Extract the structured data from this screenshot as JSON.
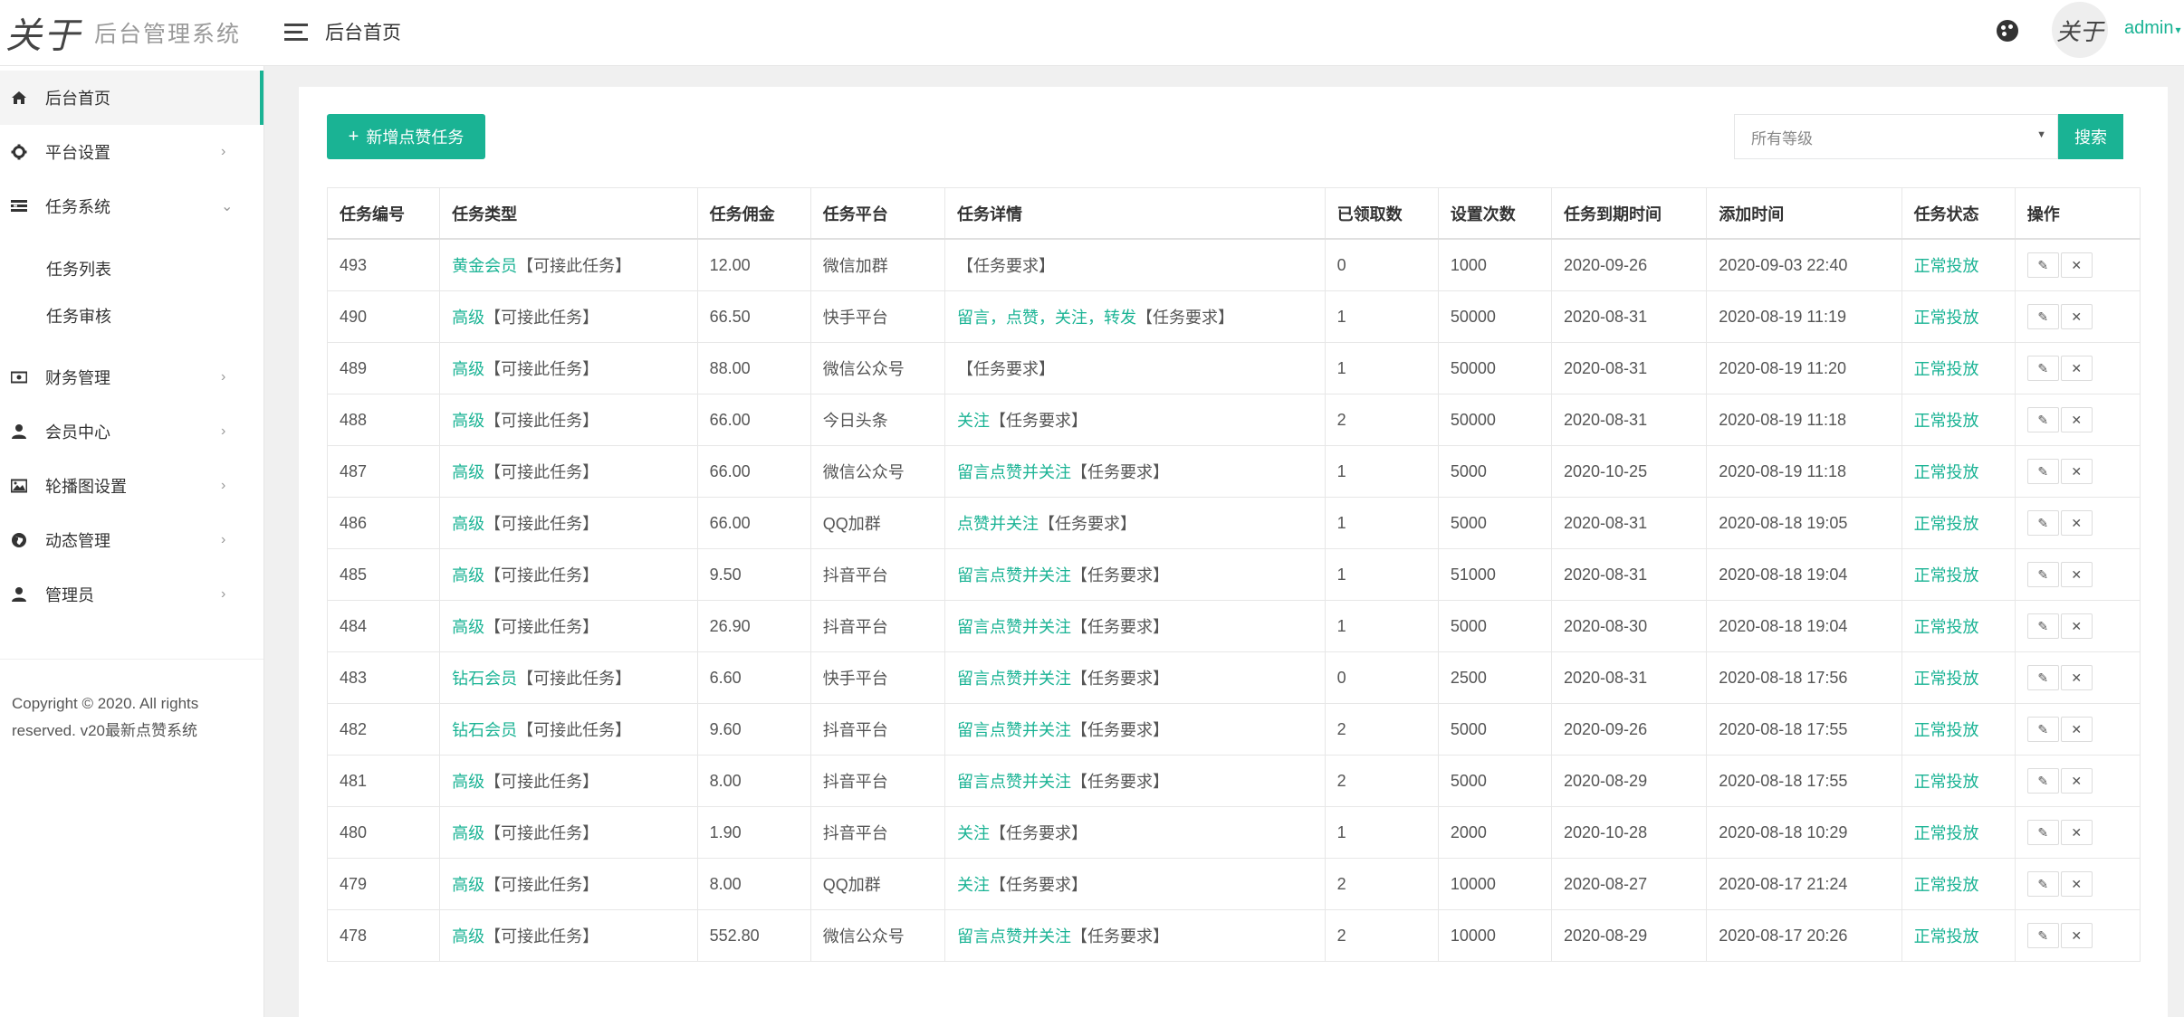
{
  "header": {
    "logo_mark": "关于",
    "system_title": "后台管理系统",
    "page_title": "后台首页",
    "avatar_text": "关于",
    "user_name": "admin"
  },
  "sidebar": {
    "items": [
      {
        "label": "后台首页",
        "icon": "home-icon"
      },
      {
        "label": "平台设置",
        "icon": "gear-icon"
      },
      {
        "label": "任务系统",
        "icon": "tasks-icon"
      },
      {
        "label": "财务管理",
        "icon": "money-icon"
      },
      {
        "label": "会员中心",
        "icon": "user-icon"
      },
      {
        "label": "轮播图设置",
        "icon": "picture-icon"
      },
      {
        "label": "动态管理",
        "icon": "globe-icon"
      },
      {
        "label": "管理员",
        "icon": "user-icon"
      }
    ],
    "sub_items": [
      {
        "label": "任务列表"
      },
      {
        "label": "任务审核"
      }
    ],
    "copyright_line1": "Copyright © 2020. All rights",
    "copyright_line2": "reserved. v20最新点赞系统"
  },
  "toolbar": {
    "add_label": "新增点赞任务",
    "select_value": "所有等级",
    "search_label": "搜索"
  },
  "table": {
    "headers": [
      "任务编号",
      "任务类型",
      "任务佣金",
      "任务平台",
      "任务详情",
      "已领取数",
      "设置次数",
      "任务到期时间",
      "添加时间",
      "任务状态",
      "操作"
    ],
    "rows": [
      {
        "id": "493",
        "type_level": "黄金会员",
        "type_note": "【可接此任务】",
        "commission": "12.00",
        "platform": "微信加群",
        "detail_tags": "",
        "detail_note": "【任务要求】",
        "received": "0",
        "times": "1000",
        "expire": "2020-09-26",
        "added": "2020-09-03 22:40",
        "status": "正常投放"
      },
      {
        "id": "490",
        "type_level": "高级",
        "type_note": "【可接此任务】",
        "commission": "66.50",
        "platform": "快手平台",
        "detail_tags": "留言，点赞，关注，转发",
        "detail_note": "【任务要求】",
        "received": "1",
        "times": "50000",
        "expire": "2020-08-31",
        "added": "2020-08-19 11:19",
        "status": "正常投放"
      },
      {
        "id": "489",
        "type_level": "高级",
        "type_note": "【可接此任务】",
        "commission": "88.00",
        "platform": "微信公众号",
        "detail_tags": "",
        "detail_note": "【任务要求】",
        "received": "1",
        "times": "50000",
        "expire": "2020-08-31",
        "added": "2020-08-19 11:20",
        "status": "正常投放"
      },
      {
        "id": "488",
        "type_level": "高级",
        "type_note": "【可接此任务】",
        "commission": "66.00",
        "platform": "今日头条",
        "detail_tags": "关注",
        "detail_note": "【任务要求】",
        "received": "2",
        "times": "50000",
        "expire": "2020-08-31",
        "added": "2020-08-19 11:18",
        "status": "正常投放"
      },
      {
        "id": "487",
        "type_level": "高级",
        "type_note": "【可接此任务】",
        "commission": "66.00",
        "platform": "微信公众号",
        "detail_tags": "留言点赞并关注",
        "detail_note": "【任务要求】",
        "received": "1",
        "times": "5000",
        "expire": "2020-10-25",
        "added": "2020-08-19 11:18",
        "status": "正常投放"
      },
      {
        "id": "486",
        "type_level": "高级",
        "type_note": "【可接此任务】",
        "commission": "66.00",
        "platform": "QQ加群",
        "detail_tags": "点赞并关注",
        "detail_note": "【任务要求】",
        "received": "1",
        "times": "5000",
        "expire": "2020-08-31",
        "added": "2020-08-18 19:05",
        "status": "正常投放"
      },
      {
        "id": "485",
        "type_level": "高级",
        "type_note": "【可接此任务】",
        "commission": "9.50",
        "platform": "抖音平台",
        "detail_tags": "留言点赞并关注",
        "detail_note": "【任务要求】",
        "received": "1",
        "times": "51000",
        "expire": "2020-08-31",
        "added": "2020-08-18 19:04",
        "status": "正常投放"
      },
      {
        "id": "484",
        "type_level": "高级",
        "type_note": "【可接此任务】",
        "commission": "26.90",
        "platform": "抖音平台",
        "detail_tags": "留言点赞并关注",
        "detail_note": "【任务要求】",
        "received": "1",
        "times": "5000",
        "expire": "2020-08-30",
        "added": "2020-08-18 19:04",
        "status": "正常投放"
      },
      {
        "id": "483",
        "type_level": "钻石会员",
        "type_note": "【可接此任务】",
        "commission": "6.60",
        "platform": "快手平台",
        "detail_tags": "留言点赞并关注",
        "detail_note": "【任务要求】",
        "received": "0",
        "times": "2500",
        "expire": "2020-08-31",
        "added": "2020-08-18 17:56",
        "status": "正常投放"
      },
      {
        "id": "482",
        "type_level": "钻石会员",
        "type_note": "【可接此任务】",
        "commission": "9.60",
        "platform": "抖音平台",
        "detail_tags": "留言点赞并关注",
        "detail_note": "【任务要求】",
        "received": "2",
        "times": "5000",
        "expire": "2020-09-26",
        "added": "2020-08-18 17:55",
        "status": "正常投放"
      },
      {
        "id": "481",
        "type_level": "高级",
        "type_note": "【可接此任务】",
        "commission": "8.00",
        "platform": "抖音平台",
        "detail_tags": "留言点赞并关注",
        "detail_note": "【任务要求】",
        "received": "2",
        "times": "5000",
        "expire": "2020-08-29",
        "added": "2020-08-18 17:55",
        "status": "正常投放"
      },
      {
        "id": "480",
        "type_level": "高级",
        "type_note": "【可接此任务】",
        "commission": "1.90",
        "platform": "抖音平台",
        "detail_tags": "关注",
        "detail_note": "【任务要求】",
        "received": "1",
        "times": "2000",
        "expire": "2020-10-28",
        "added": "2020-08-18 10:29",
        "status": "正常投放"
      },
      {
        "id": "479",
        "type_level": "高级",
        "type_note": "【可接此任务】",
        "commission": "8.00",
        "platform": "QQ加群",
        "detail_tags": "关注",
        "detail_note": "【任务要求】",
        "received": "2",
        "times": "10000",
        "expire": "2020-08-27",
        "added": "2020-08-17 21:24",
        "status": "正常投放"
      },
      {
        "id": "478",
        "type_level": "高级",
        "type_note": "【可接此任务】",
        "commission": "552.80",
        "platform": "微信公众号",
        "detail_tags": "留言点赞并关注",
        "detail_note": "【任务要求】",
        "received": "2",
        "times": "10000",
        "expire": "2020-08-29",
        "added": "2020-08-17 20:26",
        "status": "正常投放"
      }
    ]
  },
  "colors": {
    "accent": "#1ab394",
    "page_bg": "#f0f0f0"
  }
}
